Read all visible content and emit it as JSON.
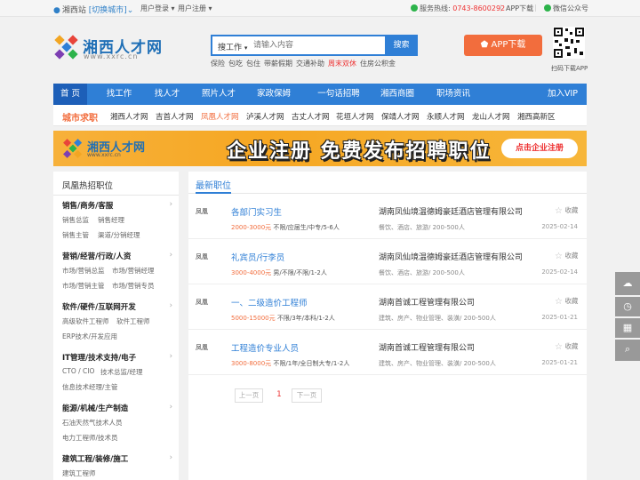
{
  "topbar": {
    "site": "湘西站",
    "switch": "[切换城市]",
    "login": "用户登录",
    "register": "用户注册",
    "hotline_label": "服务热线:",
    "hotline": "0743-8600292",
    "app_download": "APP下载",
    "wechat": "微信公众号"
  },
  "logo": {
    "name": "湘西人才网",
    "url": "www.xxrc.cn"
  },
  "search": {
    "type": "搜工作",
    "placeholder": "请输入内容",
    "button": "搜索"
  },
  "hot_tags": [
    "保险",
    "包吃",
    "包住",
    "带薪假期",
    "交通补助",
    "周末双休",
    "住房公积金"
  ],
  "app_button": "APP下载",
  "qr_label": "扫码下载APP",
  "nav": [
    "首 页",
    "找工作",
    "找人才",
    "照片人才",
    "家政保姆",
    "一句话招聘",
    "湘西商圈",
    "职场资讯",
    "加入VIP"
  ],
  "cities": {
    "label": "城市求职",
    "items": [
      "湘西人才网",
      "吉首人才网",
      "凤凰人才网",
      "泸溪人才网",
      "古丈人才网",
      "花垣人才网",
      "保靖人才网",
      "永顺人才网",
      "龙山人才网",
      "湘西高新区"
    ],
    "current": 2
  },
  "banner": {
    "logo_name": "湘西人才网",
    "logo_url": "www.xxrc.cn",
    "headline": "企业注册 免费发布招聘职位",
    "cta": "点击企业注册"
  },
  "sidebar": {
    "title": "凤凰热招职位",
    "categories": [
      {
        "title": "销售/商务/客服",
        "subs": [
          "销售总监",
          "销售经理",
          "销售主管",
          "渠道/分销经理"
        ]
      },
      {
        "title": "营销/经营/行政/人资",
        "subs": [
          "市场/营销总监",
          "市场/营销经理",
          "市场/营销主管",
          "市场/营销专员"
        ]
      },
      {
        "title": "软件/硬件/互联网开发",
        "subs": [
          "高级软件工程师",
          "软件工程师",
          "ERP技术/开发应用"
        ]
      },
      {
        "title": "IT管理/技术支持/电子",
        "subs": [
          "CTO / CIO",
          "技术总监/经理",
          "信息技术经理/主管"
        ]
      },
      {
        "title": "能源/机械/生产制造",
        "subs": [
          "石油天然气技术人员",
          "电力工程师/技术员"
        ]
      },
      {
        "title": "建筑工程/装修/施工",
        "subs": [
          "建筑工程师"
        ]
      }
    ]
  },
  "main": {
    "title": "最新职位",
    "jobs": [
      {
        "source": "凤凰",
        "title": "各部门实习生",
        "salary": "2000-3000元",
        "req": " 不限/应届生/中专/5-6人",
        "company": "湖南凤仙境温德姆豪廷酒店管理有限公司",
        "industry": "餐饮、酒店、旅游/ 200-500人",
        "fav": "收藏",
        "date": "2025-02-14"
      },
      {
        "source": "凤凰",
        "title": "礼宾员/行李员",
        "salary": "3000-4000元",
        "req": " 男/不限/不限/1-2人",
        "company": "湖南凤仙境温德姆豪廷酒店管理有限公司",
        "industry": "餐饮、酒店、旅游/ 200-500人",
        "fav": "收藏",
        "date": "2025-02-14"
      },
      {
        "source": "凤凰",
        "title": "一、二级造价工程师",
        "salary": "5000-15000元",
        "req": " 不限/3年/本科/1-2人",
        "company": "湖南首诚工程管理有限公司",
        "industry": "建筑、房产、物业管理、装潢/ 200-500人",
        "fav": "收藏",
        "date": "2025-01-21"
      },
      {
        "source": "凤凰",
        "title": "工程造价专业人员",
        "salary": "3000-8000元",
        "req": " 不限/1年/全日制大专/1-2人",
        "company": "湖南首诚工程管理有限公司",
        "industry": "建筑、房产、物业管理、装潢/ 200-500人",
        "fav": "收藏",
        "date": "2025-01-21"
      }
    ],
    "pager": {
      "prev": "上一页",
      "page": "1",
      "next": "下一页"
    }
  },
  "colors": {
    "primary": "#2f7fd6",
    "accent": "#f26d3d",
    "nav_active": "#1d5fb8"
  }
}
